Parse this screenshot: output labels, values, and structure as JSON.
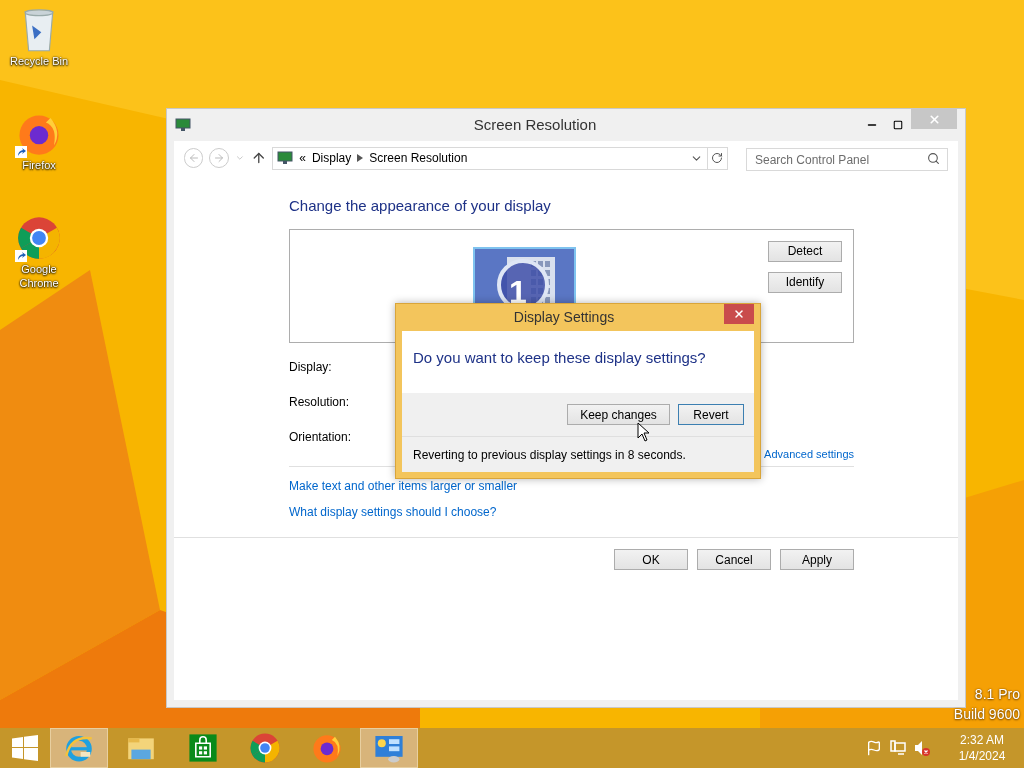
{
  "desktop_icons": [
    {
      "label": "Recycle Bin",
      "kind": "recycle",
      "shortcut": false
    },
    {
      "label": "Firefox",
      "kind": "firefox",
      "shortcut": true
    },
    {
      "label": "Google Chrome",
      "kind": "chrome",
      "shortcut": true
    }
  ],
  "window": {
    "title": "Screen Resolution",
    "breadcrumb": [
      "«",
      "Display",
      "Screen Resolution"
    ],
    "search": {
      "placeholder": "Search Control Panel"
    },
    "heading": "Change the appearance of your display",
    "monitor_number": "1",
    "side_buttons": [
      "Detect",
      "Identify"
    ],
    "form_labels": [
      "Display:",
      "Resolution:",
      "Orientation:"
    ],
    "advanced_link": "Advanced settings",
    "links": [
      "Make text and other items larger or smaller",
      "What display settings should I choose?"
    ],
    "footer_buttons": [
      "OK",
      "Cancel",
      "Apply"
    ]
  },
  "dialog": {
    "title": "Display Settings",
    "question": "Do you want to keep these display settings?",
    "buttons": [
      {
        "label": "Keep changes",
        "default": false
      },
      {
        "label": "Revert",
        "default": true
      }
    ],
    "countdown": "Reverting to previous display settings in 8 seconds."
  },
  "os_edition_text": [
    "8.1 Pro",
    "Build 9600"
  ],
  "taskbar": {
    "apps": [
      {
        "kind": "ie",
        "active": true
      },
      {
        "kind": "explorer",
        "active": false
      },
      {
        "kind": "store",
        "active": false
      },
      {
        "kind": "chrome",
        "active": false
      },
      {
        "kind": "firefox",
        "active": false
      },
      {
        "kind": "control-panel",
        "active": true
      }
    ],
    "clock": {
      "time": "2:32 AM",
      "date": "1/4/2024"
    }
  }
}
